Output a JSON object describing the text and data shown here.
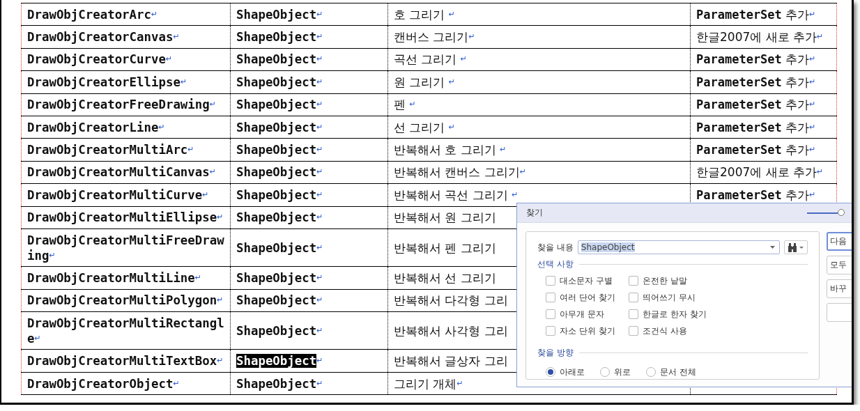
{
  "document": {
    "rows": [
      {
        "match_highlighted": false,
        "cells": [
          {
            "text": "DrawObjCreatorArc",
            "end_mark": "↵"
          },
          {
            "text": "ShapeObject",
            "end_mark": "↵"
          },
          {
            "text": "호 그리기 ",
            "end_mark": "↵"
          },
          {
            "text": "**ParameterSet** 추가",
            "end_mark": "↵"
          }
        ]
      },
      {
        "match_highlighted": false,
        "cells": [
          {
            "text": "DrawObjCreatorCanvas",
            "end_mark": "↵"
          },
          {
            "text": "ShapeObject",
            "end_mark": "↵"
          },
          {
            "text": "캔버스 그리기",
            "end_mark": "↵"
          },
          {
            "text": "한글2007에 새로 추가",
            "end_mark": "↵"
          }
        ]
      },
      {
        "match_highlighted": false,
        "cells": [
          {
            "text": "DrawObjCreatorCurve",
            "end_mark": "↵"
          },
          {
            "text": "ShapeObject",
            "end_mark": "↵"
          },
          {
            "text": "곡선 그리기 ",
            "end_mark": "↵"
          },
          {
            "text": "**ParameterSet** 추가",
            "end_mark": "↵"
          }
        ]
      },
      {
        "match_highlighted": false,
        "cells": [
          {
            "text": "DrawObjCreatorEllipse",
            "end_mark": "↵"
          },
          {
            "text": "ShapeObject",
            "end_mark": "↵"
          },
          {
            "text": "원 그리기 ",
            "end_mark": "↵"
          },
          {
            "text": "**ParameterSet** 추가",
            "end_mark": "↵"
          }
        ]
      },
      {
        "match_highlighted": false,
        "cells": [
          {
            "text": "DrawObjCreatorFreeDrawing",
            "end_mark": "↵"
          },
          {
            "text": "ShapeObject",
            "end_mark": "↵"
          },
          {
            "text": "펜 ",
            "end_mark": "↵"
          },
          {
            "text": "**ParameterSet** 추가",
            "end_mark": "↵"
          }
        ]
      },
      {
        "match_highlighted": false,
        "cells": [
          {
            "text": "DrawObjCreatorLine",
            "end_mark": "↵"
          },
          {
            "text": "ShapeObject",
            "end_mark": "↵"
          },
          {
            "text": "선 그리기 ",
            "end_mark": "↵"
          },
          {
            "text": "**ParameterSet** 추가",
            "end_mark": "↵"
          }
        ]
      },
      {
        "match_highlighted": false,
        "cells": [
          {
            "text": "DrawObjCreatorMultiArc",
            "end_mark": "↵"
          },
          {
            "text": "ShapeObject",
            "end_mark": "↵"
          },
          {
            "text": "반복해서 호 그리기 ",
            "end_mark": "↵"
          },
          {
            "text": "**ParameterSet** 추가",
            "end_mark": "↵"
          }
        ]
      },
      {
        "match_highlighted": false,
        "cells": [
          {
            "text": "DrawObjCreatorMultiCanvas",
            "end_mark": "↵"
          },
          {
            "text": "ShapeObject",
            "end_mark": "↵"
          },
          {
            "text": "반복해서 캔버스 그리기",
            "end_mark": "↵"
          },
          {
            "text": "한글2007에 새로 추가",
            "end_mark": "↵"
          }
        ]
      },
      {
        "match_highlighted": false,
        "cells": [
          {
            "text": "DrawObjCreatorMultiCurve",
            "end_mark": "↵"
          },
          {
            "text": "ShapeObject",
            "end_mark": "↵"
          },
          {
            "text": "반복해서 곡선 그리기 ",
            "end_mark": "↵"
          },
          {
            "text": "**ParameterSet** 추가",
            "end_mark": "↵"
          }
        ]
      },
      {
        "match_highlighted": false,
        "cells": [
          {
            "text": "DrawObjCreatorMultiEllipse",
            "end_mark": "↵"
          },
          {
            "text": "ShapeObject",
            "end_mark": "↵"
          },
          {
            "text": "반복해서 원 그리기"
          }
        ]
      },
      {
        "match_highlighted": false,
        "cells": [
          {
            "text": "DrawObjCreatorMultiFreeDrawing",
            "end_mark": "↵"
          },
          {
            "text": "ShapeObject",
            "end_mark": "↵"
          },
          {
            "text": "반복해서 펜 그리기"
          }
        ]
      },
      {
        "match_highlighted": false,
        "cells": [
          {
            "text": "DrawObjCreatorMultiLine",
            "end_mark": "↵"
          },
          {
            "text": "ShapeObject",
            "end_mark": "↵"
          },
          {
            "text": "반복해서 선 그리기"
          }
        ]
      },
      {
        "match_highlighted": false,
        "cells": [
          {
            "text": "DrawObjCreatorMultiPolygon",
            "end_mark": "↵"
          },
          {
            "text": "ShapeObject",
            "end_mark": "↵"
          },
          {
            "text": "반복해서 다각형 그리"
          }
        ]
      },
      {
        "match_highlighted": false,
        "cells": [
          {
            "text": "DrawObjCreatorMultiRectangle",
            "end_mark": "↵"
          },
          {
            "text": "ShapeObject",
            "end_mark": "↵"
          },
          {
            "text": "반복해서 사각형 그리"
          }
        ]
      },
      {
        "match_highlighted": true,
        "cells": [
          {
            "text": "DrawObjCreatorMultiTextBox",
            "end_mark": "↵"
          },
          {
            "text": "ShapeObject",
            "end_mark": "↵"
          },
          {
            "text": "반복해서 글상자 그리"
          }
        ]
      },
      {
        "match_highlighted": false,
        "cells": [
          {
            "text": "DrawObjCreatorObject",
            "end_mark": "↵"
          },
          {
            "text": "ShapeObject",
            "end_mark": "↵"
          },
          {
            "text": "그리기 개체",
            "end_mark": "↵"
          }
        ]
      }
    ]
  },
  "find_dialog": {
    "title": "찾기",
    "opacity_slider": {
      "level": 1
    },
    "search": {
      "label": "찾을 내용",
      "value": "ShapeObject",
      "value_selected": true
    },
    "options_heading": "선택 사항",
    "options": [
      {
        "label": "대소문자 구별",
        "checked": false
      },
      {
        "label": "온전한 낱말",
        "checked": false
      },
      {
        "label": "여러 단어 찾기",
        "checked": false
      },
      {
        "label": "띄어쓰기 무시",
        "checked": false
      },
      {
        "label": "아무개 문자",
        "checked": false
      },
      {
        "label": "한글로 한자 찾기",
        "checked": false
      },
      {
        "label": "자소 단위 찾기",
        "checked": false
      },
      {
        "label": "조건식 사용",
        "checked": false
      }
    ],
    "direction_heading": "찾을 방향",
    "directions": [
      {
        "label": "아래로",
        "selected": true
      },
      {
        "label": "위로",
        "selected": false
      },
      {
        "label": "문서 전체",
        "selected": false
      }
    ],
    "buttons": [
      {
        "label": "다음",
        "focused": true
      },
      {
        "label": "모두",
        "focused": false
      },
      {
        "label": "바꾸",
        "focused": false
      },
      {
        "focused": false
      }
    ]
  }
}
